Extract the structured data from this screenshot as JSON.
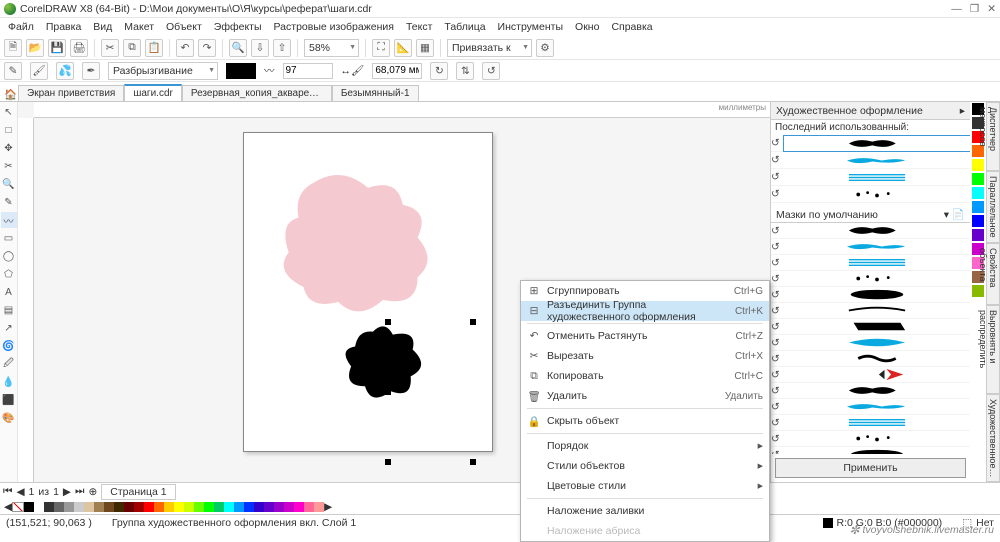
{
  "title": "CorelDRAW X8 (64-Bit) - D:\\Мои документы\\О\\Я\\курсы\\реферат\\шаги.cdr",
  "menus": [
    "Файл",
    "Правка",
    "Вид",
    "Макет",
    "Объект",
    "Эффекты",
    "Растровые изображения",
    "Текст",
    "Таблица",
    "Инструменты",
    "Окно",
    "Справка"
  ],
  "zoom": "58%",
  "snap_label": "Привязать к",
  "prop": {
    "tool": "Разбрызгивание",
    "size": "97",
    "dist": "68,079 мм"
  },
  "tabs": [
    {
      "label": "Экран приветствия",
      "active": false
    },
    {
      "label": "шаги.cdr",
      "active": true
    },
    {
      "label": "Резервная_копия_акварель2.cdr",
      "active": false
    },
    {
      "label": "Безымянный-1",
      "active": false
    }
  ],
  "ruler_unit": "миллиметры",
  "context_menu": [
    {
      "icon": "⊞",
      "label": "Сгруппировать",
      "shortcut": "Ctrl+G"
    },
    {
      "icon": "⊟",
      "label": "Разъединить Группа художественного оформления",
      "shortcut": "Ctrl+K",
      "hl": true
    },
    {
      "sep": true
    },
    {
      "icon": "↶",
      "label": "Отменить Растянуть",
      "shortcut": "Ctrl+Z"
    },
    {
      "icon": "✂",
      "label": "Вырезать",
      "shortcut": "Ctrl+X"
    },
    {
      "icon": "⧉",
      "label": "Копировать",
      "shortcut": "Ctrl+C"
    },
    {
      "icon": "🗑",
      "label": "Удалить",
      "shortcut": "Удалить"
    },
    {
      "sep": true
    },
    {
      "icon": "🔒",
      "label": "Скрыть объект"
    },
    {
      "sep": true
    },
    {
      "label": "Порядок",
      "sub": true
    },
    {
      "label": "Стили объектов",
      "sub": true
    },
    {
      "label": "Цветовые стили",
      "sub": true
    },
    {
      "sep": true
    },
    {
      "label": "Наложение заливки"
    },
    {
      "label": "Наложение абриса",
      "disabled": true
    }
  ],
  "panel": {
    "title": "Художественное оформление",
    "last_used": "Последний использованный:",
    "default_brushes": "Мазки по умолчанию",
    "apply": "Применить"
  },
  "side_tabs": [
    "Диспетчер макросов",
    "Параллельное",
    "Свойства объекта",
    "Выровнять и распределить",
    "Художественное…"
  ],
  "palette": [
    "#000000",
    "#ffffff",
    "#333333",
    "#666666",
    "#999999",
    "#cccccc",
    "#dcc5a0",
    "#a08050",
    "#704820",
    "#402800",
    "#6b0000",
    "#a00000",
    "#ff0000",
    "#ff6600",
    "#ffcc00",
    "#ffff00",
    "#ccff00",
    "#66ff00",
    "#00ff00",
    "#00cc66",
    "#00ffff",
    "#0099ff",
    "#0033ff",
    "#3300cc",
    "#6600cc",
    "#9900cc",
    "#cc00cc",
    "#ff00cc",
    "#ff6699",
    "#ff9999"
  ],
  "page_nav": {
    "page": "1",
    "of_label": "из",
    "total": "1",
    "page_name": "Страница 1"
  },
  "status": {
    "coords": "(151,521; 90,063 )",
    "object": "Группа художественного оформления вкл. Слой 1",
    "fill": "R:0 G:0 B:0 (#000000)",
    "outline": "Нет"
  },
  "watermark": "tvoyvolshebnik.livemaster.ru",
  "side_palette": [
    "#000",
    "#333",
    "#f00",
    "#f60",
    "#ff0",
    "#0f0",
    "#0ff",
    "#09f",
    "#00f",
    "#60c",
    "#c0c",
    "#f6c",
    "#964",
    "#8b0"
  ]
}
